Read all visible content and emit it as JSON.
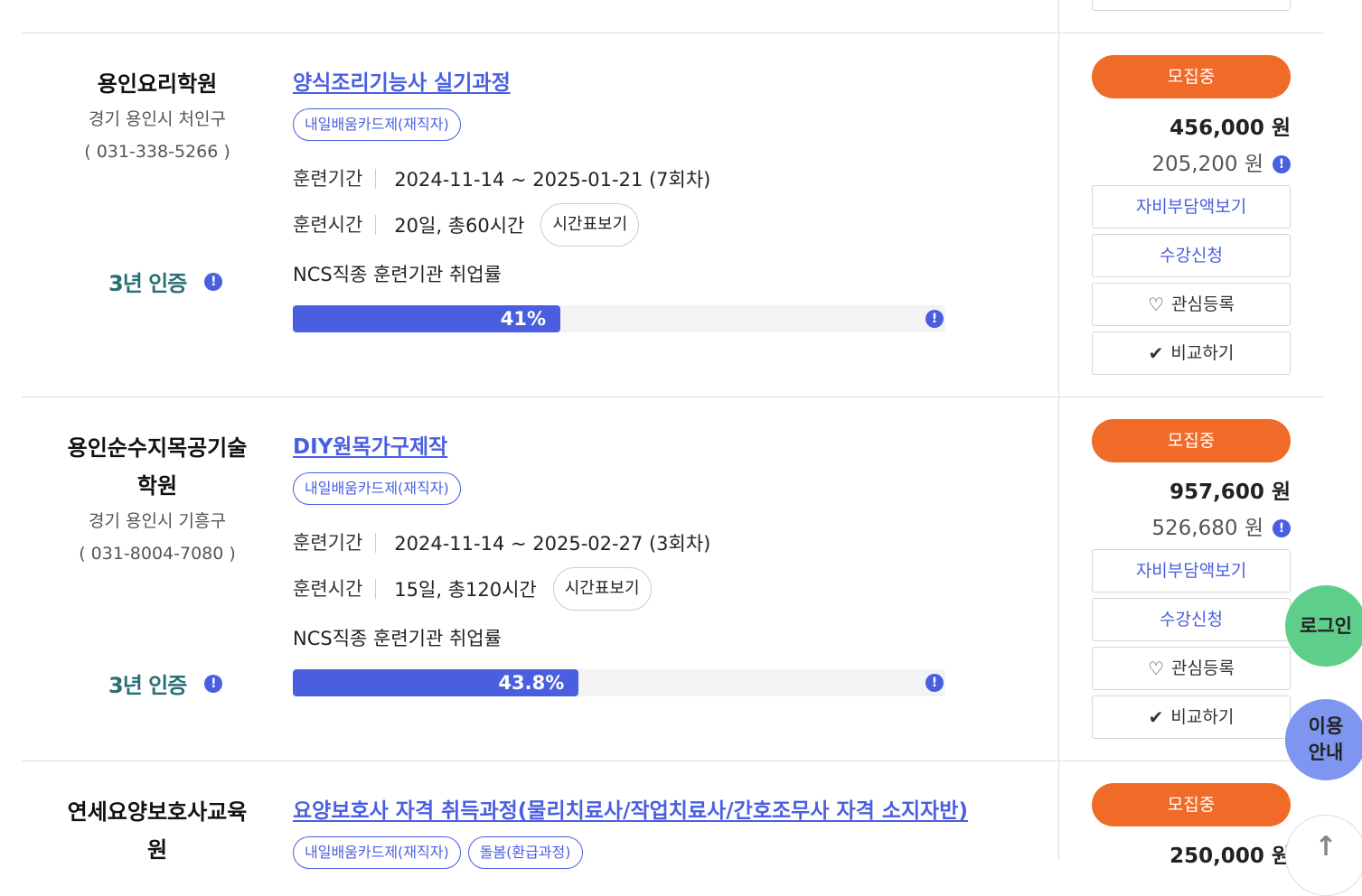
{
  "courses": [
    {
      "institution": "용인요리학원",
      "address": "경기 용인시 처인구",
      "phone": "( 031-338-5266 )",
      "cert_label": "3년 인증",
      "title": "양식조리기능사 실기과정",
      "tags": [
        "내일배움카드제(재직자)"
      ],
      "period_label": "훈련기간",
      "period": "2024-11-14 ~ 2025-01-21 (7회차)",
      "hours_label": "훈련시간",
      "hours": "20일, 총60시간",
      "timetable_label": "시간표보기",
      "ncs_label": "NCS직종 훈련기관 취업률",
      "employment_rate": 41,
      "employment_rate_text": "41%",
      "status": "모집중",
      "price": "456,000 원",
      "self_pay": "205,200 원",
      "btn_self_pay": "자비부담액보기",
      "btn_apply": "수강신청",
      "btn_interest": "관심등록",
      "btn_compare": "비교하기"
    },
    {
      "institution_line1": "용인순수지목공기술",
      "institution_line2": "학원",
      "address": "경기 용인시 기흥구",
      "phone": "( 031-8004-7080 )",
      "cert_label": "3년 인증",
      "title": "DIY원목가구제작",
      "tags": [
        "내일배움카드제(재직자)"
      ],
      "period_label": "훈련기간",
      "period": "2024-11-14 ~ 2025-02-27 (3회차)",
      "hours_label": "훈련시간",
      "hours": "15일, 총120시간",
      "timetable_label": "시간표보기",
      "ncs_label": "NCS직종 훈련기관 취업률",
      "employment_rate": 43.8,
      "employment_rate_text": "43.8%",
      "status": "모집중",
      "price": "957,600 원",
      "self_pay": "526,680 원",
      "btn_self_pay": "자비부담액보기",
      "btn_apply": "수강신청",
      "btn_interest": "관심등록",
      "btn_compare": "비교하기"
    },
    {
      "institution_line1": "연세요양보호사교육",
      "institution_line2": "원",
      "title": "요양보호사 자격 취득과정(물리치료사/작업치료사/간호조무사 자격 소지자반)",
      "tags": [
        "내일배움카드제(재직자)",
        "돌봄(환급과정)"
      ],
      "status": "모집중",
      "price": "250,000 원"
    }
  ],
  "floating": {
    "login": "로그인",
    "guide_line1": "이용",
    "guide_line2": "안내",
    "top": "↑"
  },
  "colors": {
    "accent": "#4a5fe0",
    "status": "#f06a28",
    "login": "#5ecf8a",
    "guide": "#7f96f0"
  },
  "icons": [
    "info-icon",
    "heart-icon",
    "check-icon",
    "arrow-up-icon"
  ]
}
